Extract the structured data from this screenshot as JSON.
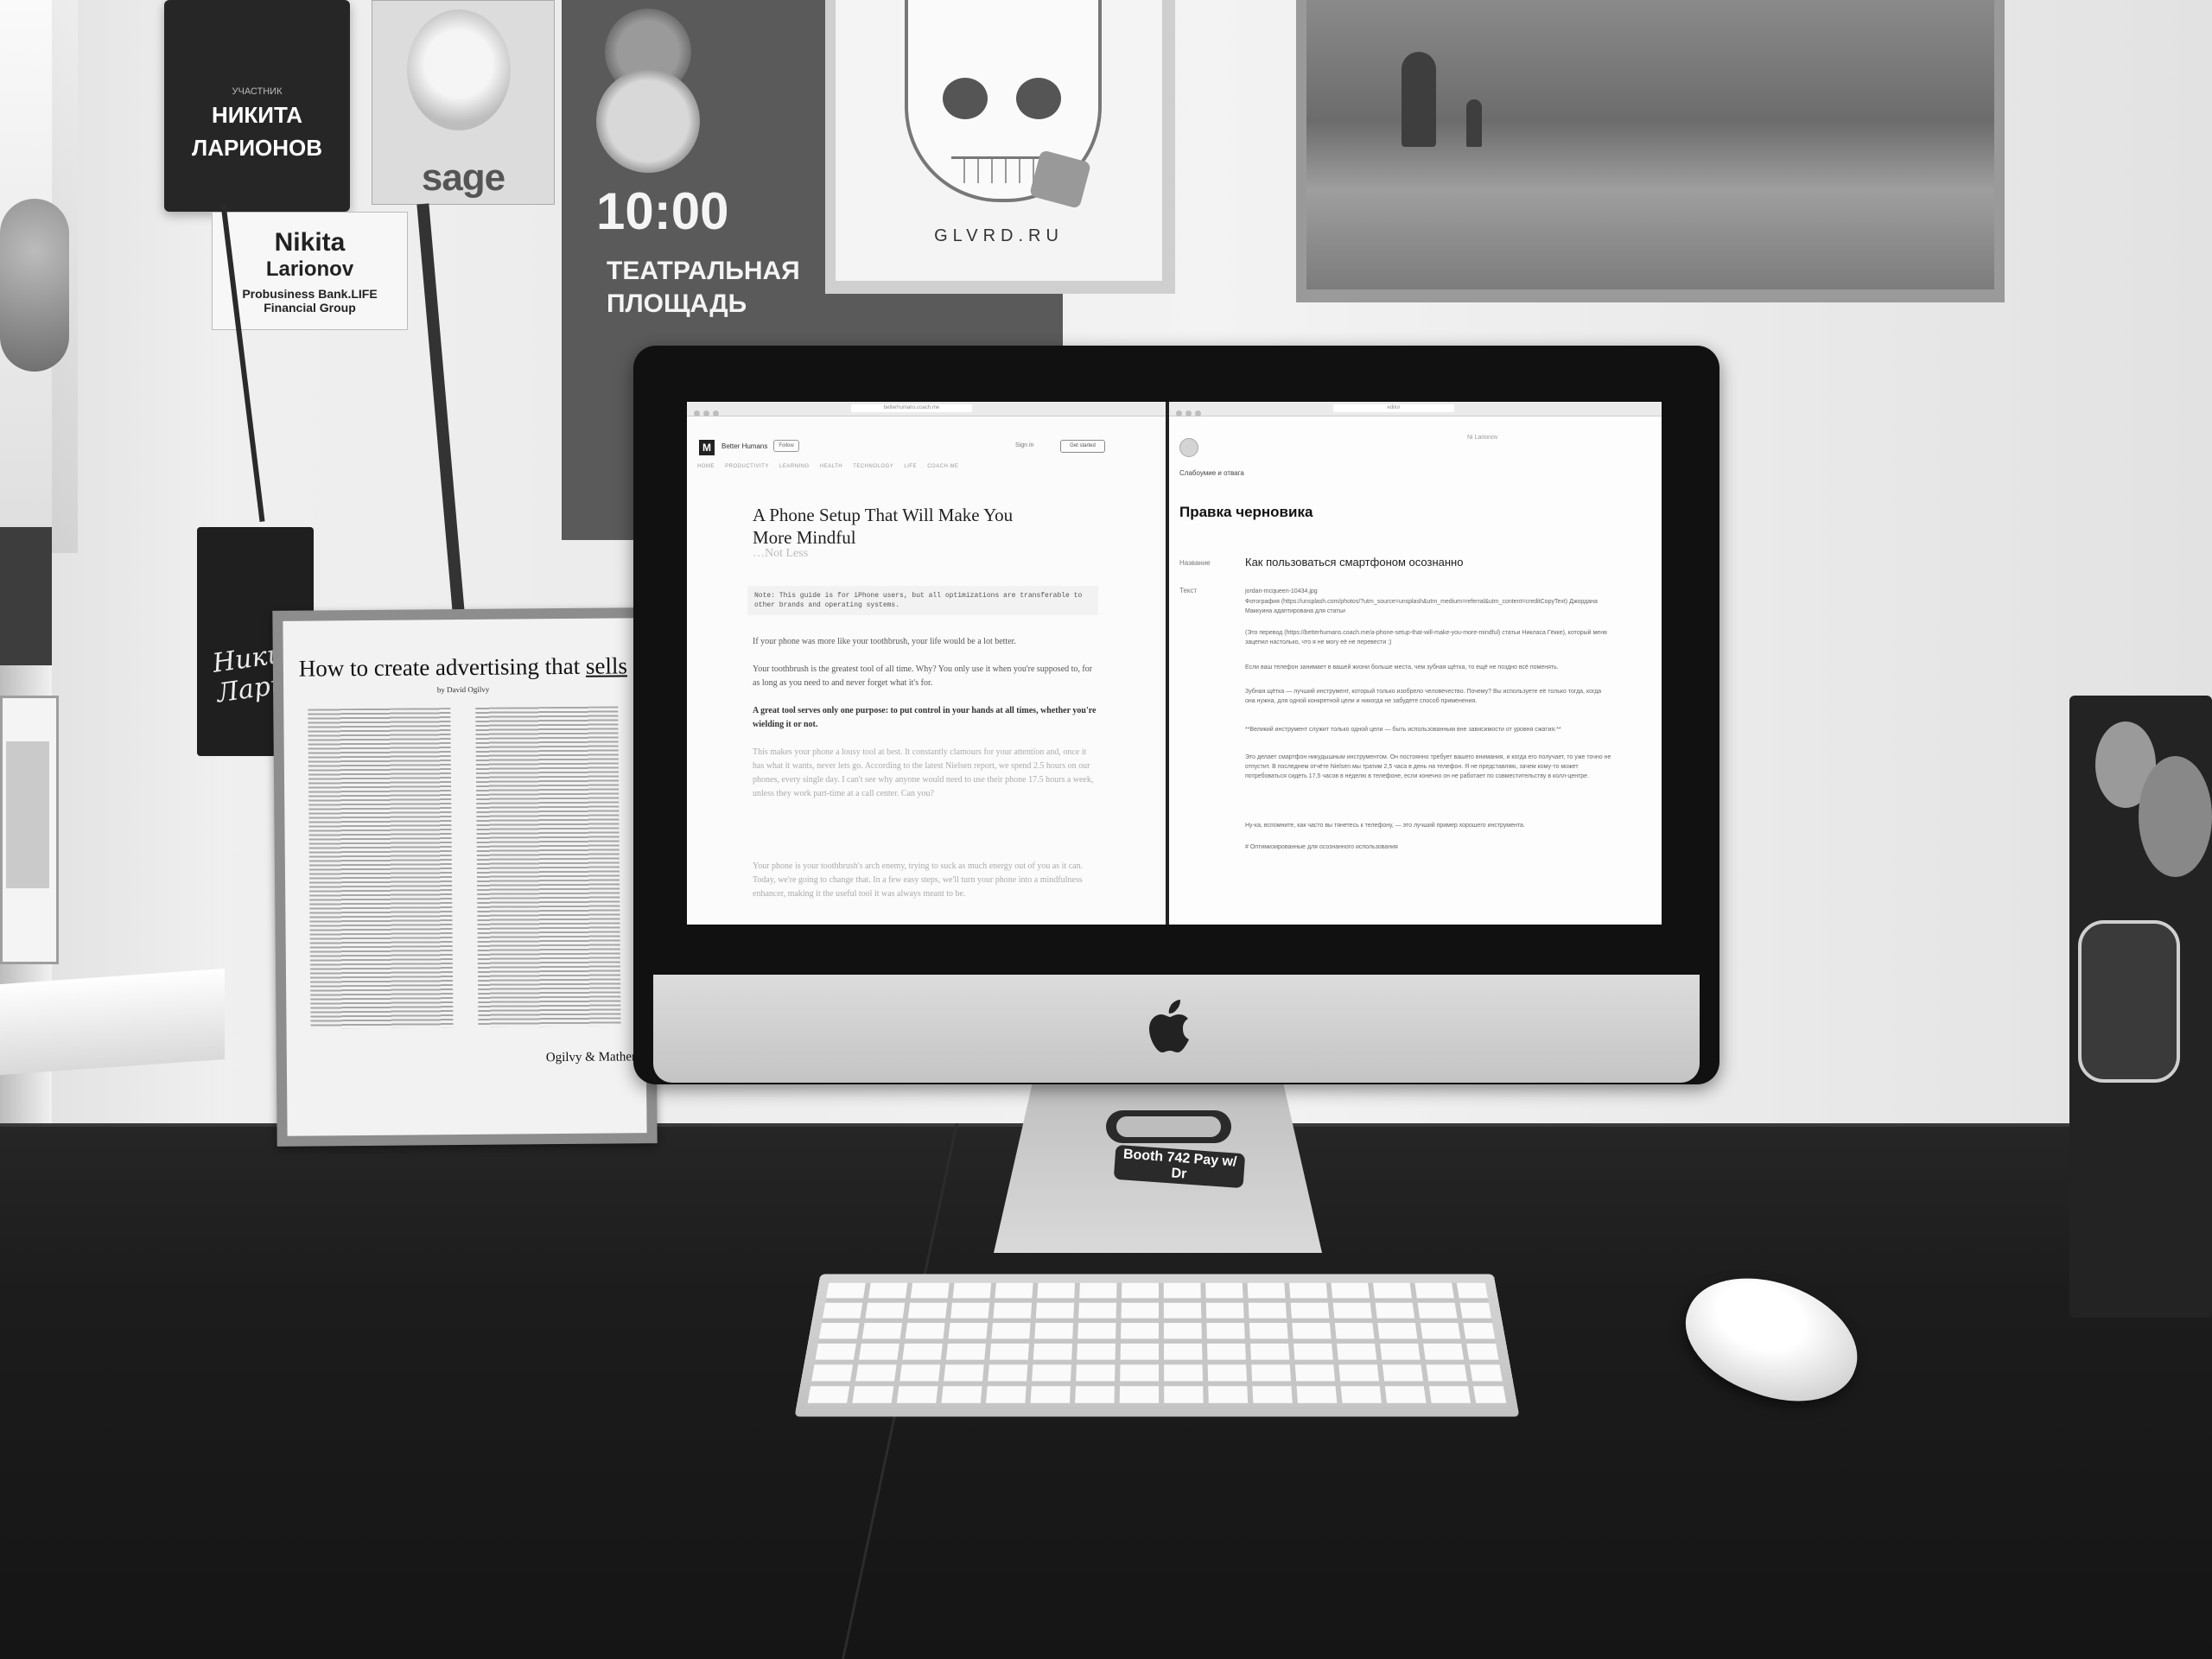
{
  "wall": {
    "badge_dark": {
      "label": "УЧАСТНИК",
      "line1": "НИКИТА",
      "line2": "ЛАРИОНОВ"
    },
    "badge_light": {
      "first": "Nikita",
      "last": "Larionov",
      "org1": "Probusiness Bank.LIFE",
      "org2": "Financial Group"
    },
    "sage_card": {
      "brand": "sage"
    },
    "poster": {
      "time": "10:00",
      "place": "ТЕАТРАЛЬНАЯ ПЛОЩАДЬ"
    },
    "skull_poster": {
      "caption": "GLVRD.RU"
    },
    "signature_tag": {
      "text": "Никита Ларионов"
    }
  },
  "ogilvy": {
    "title_pre": "How to create advertising that ",
    "title_underlined": "sells",
    "byline": "by David Ogilvy",
    "footer": "Ogilvy & Mather"
  },
  "left_pane": {
    "url": "betterhumans.coach.me",
    "logo": "M",
    "publication": "Better Humans",
    "follow": "Follow",
    "sign_in": "Sign in",
    "get_started": "Get started",
    "nav": [
      "HOME",
      "PRODUCTIVITY",
      "LEARNING",
      "HEALTH",
      "TECHNOLOGY",
      "LIFE",
      "COACH.ME"
    ],
    "title": "A Phone Setup That Will Make You More Mindful",
    "subtitle": "…Not Less",
    "note": "Note: This guide is for iPhone users, but all optimizations are transferable to other brands and operating systems.",
    "paragraphs": [
      "If your phone was more like your toothbrush, your life would be a lot better.",
      "Your toothbrush is the greatest tool of all time. Why? You only use it when you're supposed to, for as long as you need to and never forget what it's for.",
      "A great tool serves only one purpose: to put control in your hands at all times, whether you're wielding it or not.",
      "This makes your phone a lousy tool at best. It constantly clamours for your attention and, once it has what it wants, never lets go. According to the latest Nielsen report, we spend 2.5 hours on our phones, every single day. I can't see why anyone would need to use their phone 17.5 hours a week, unless they work part-time at a call center. Can you?",
      "Your phone is your toothbrush's arch enemy, trying to suck as much energy out of you as it can. Today, we're going to change that. In a few easy steps, we'll turn your phone into a mindfulness enhancer, making it the useful tool it was always meant to be."
    ]
  },
  "right_pane": {
    "url": "editor",
    "user": "Ni Larionov",
    "subtitle": "Слабоумие и отвага",
    "title": "Правка черновика",
    "name_label": "Название",
    "name_value": "Как пользоваться смартфоном осознанно",
    "text_label": "Текст",
    "text_lines": [
      "jordan-mcqueen-10434.jpg",
      "Фотография (https://unsplash.com/photos/?utm_source=unsplash&utm_medium=referral&utm_content=creditCopyText) Джордана Маккуина адаптирована для статьи",
      "(Это перевод (https://betterhumans.coach.me/a-phone-setup-that-will-make-you-more-mindful) статьи Никласа Гёкке), который меня зацепил настолько, что я не могу её не перевести ;)",
      "Если ваш телефон занимает в вашей жизни больше места, чем зубная щётка, то ещё не поздно всё поменять.",
      "Зубная щётка — лучший инструмент, который только изобрело человечество. Почему? Вы используете её только тогда, когда она нужна, для одной конкретной цели и никогда не забудете способ применения.",
      "**Великий инструмент служит только одной цели — быть использованным вне зависимости от уровня сжатия.**",
      "Это делает смартфон никудышным инструментом. Он постоянно требует вашего внимания, и когда его получает, то уже точно не отпустит. В последнем отчёте Nielsen мы тратим 2,5 часа в день на телефон. Я не представляю, зачем кому-то может потребоваться сидеть 17,5 часов в неделю в телефоне, если конечно он не работает по совместительству в колл-центре.",
      "Ну-ка, вспомните, как часто вы тянетесь к телефону, — это лучший пример хорошего инструмента.",
      "# Оптимизированные для осознанного использования"
    ]
  },
  "desk": {
    "wristband": "Booth 742   Pay w/ Dr"
  }
}
